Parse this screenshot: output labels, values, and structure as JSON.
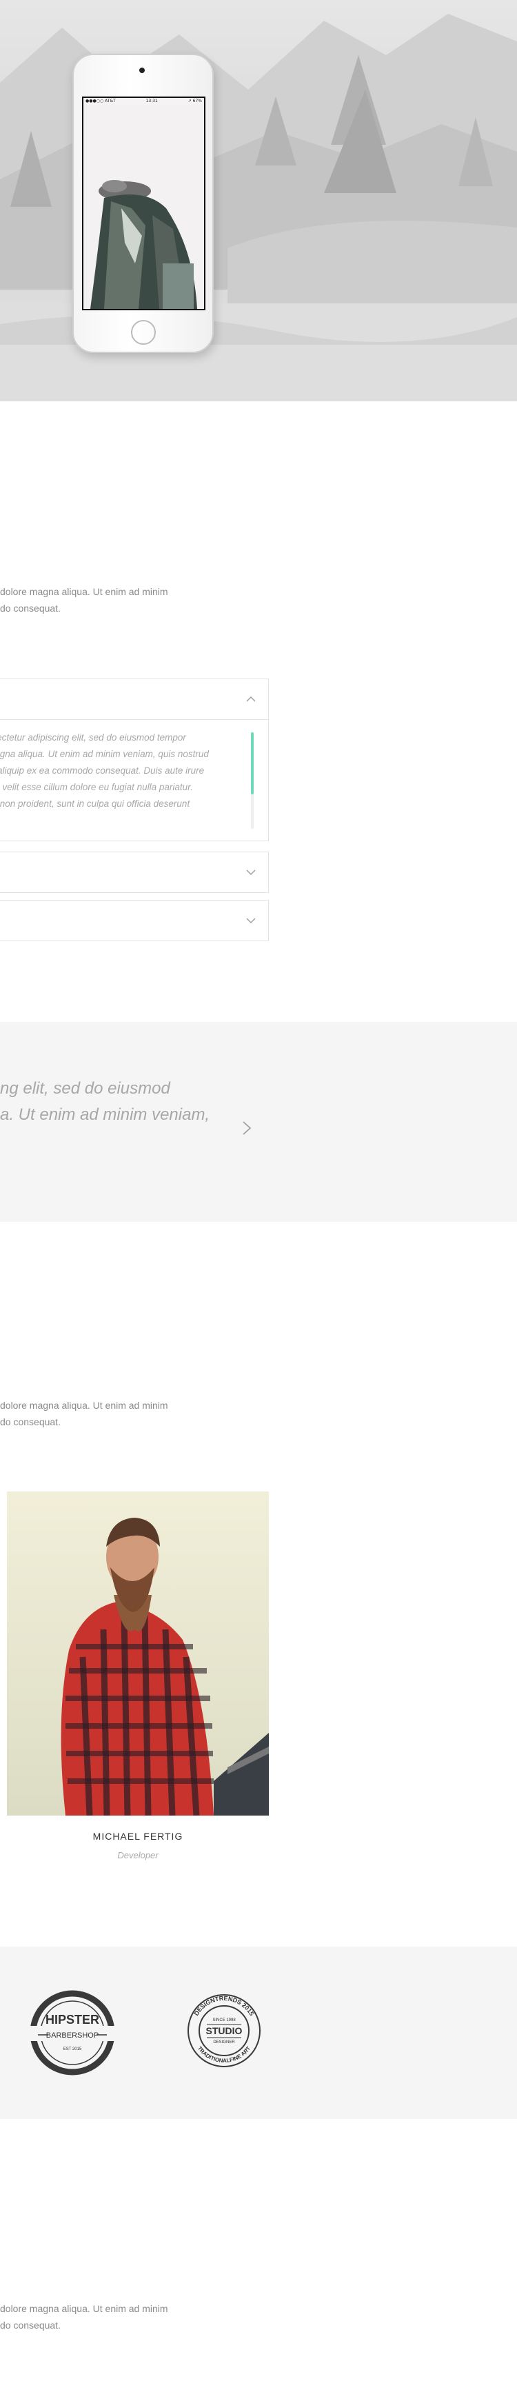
{
  "hero": {
    "phone_status": {
      "carrier": "●●●○○ AT&T",
      "time": "13:31",
      "battery": "↗ 67%"
    }
  },
  "sections": {
    "intro_1": {
      "line_1": "dolore magna aliqua. Ut enim ad minim",
      "line_2": "do consequat."
    },
    "intro_2": {
      "line_1": "dolore magna aliqua. Ut enim ad minim",
      "line_2": "do consequat."
    },
    "intro_3": {
      "line_1": "dolore magna aliqua. Ut enim ad minim",
      "line_2": "do consequat."
    }
  },
  "accordion": {
    "items": [
      {
        "expanded": true,
        "body_lines": [
          "nsectetur adipiscing elit, sed do eiusmod tempor",
          "magna aliqua. Ut enim ad minim veniam, quis nostrud",
          "ut aliquip ex ea commodo consequat. Duis aute irure",
          "ate velit esse cillum dolore eu fugiat nulla pariatur.",
          "tat non proident, sunt in culpa qui officia deserunt"
        ],
        "scroll_position": 0.64
      },
      {
        "expanded": false
      },
      {
        "expanded": false
      }
    ]
  },
  "quote": {
    "line_1": "ng elit, sed do eiusmod",
    "line_2": "a. Ut enim ad minim veniam,"
  },
  "team": {
    "member": {
      "name": "MICHAEL FERTIG",
      "role": "Developer"
    }
  },
  "logos": {
    "hipster": {
      "title": "HIPSTER",
      "subtitle": "BARBERSHOP",
      "tag": "EST 2015"
    },
    "studio": {
      "ring_top": "DESIGNTRENDS 2015",
      "since": "SINCE 1998",
      "title": "STUDIO",
      "designer": "DESIGNER",
      "ring_bottom": "TRADITIONALFINE ART"
    }
  },
  "colors": {
    "accent": "#6fdab9",
    "band": "#f5f5f5",
    "border": "#e3e3e3"
  }
}
